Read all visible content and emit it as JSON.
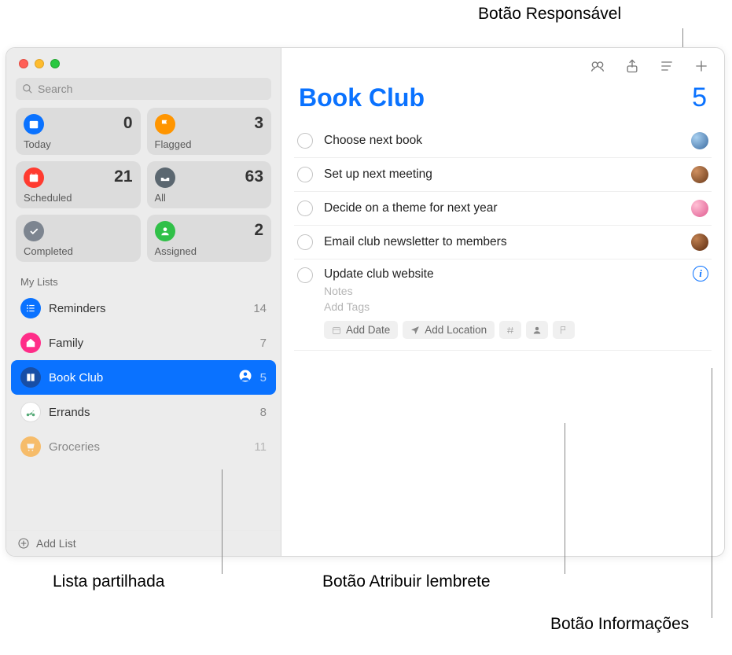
{
  "callouts": {
    "top_right": "Botão Responsável",
    "bottom_left": "Lista partilhada",
    "bottom_mid": "Botão Atribuir lembrete",
    "bottom_right": "Botão Informações"
  },
  "sidebar": {
    "search_placeholder": "Search",
    "cards": [
      {
        "label": "Today",
        "count": "0",
        "color": "#0a72ff",
        "icon": "calendar"
      },
      {
        "label": "Flagged",
        "count": "3",
        "color": "#ff9500",
        "icon": "flag"
      },
      {
        "label": "Scheduled",
        "count": "21",
        "color": "#ff3b30",
        "icon": "schedule"
      },
      {
        "label": "All",
        "count": "63",
        "color": "#5b6770",
        "icon": "tray"
      },
      {
        "label": "Completed",
        "count": "",
        "color": "#7d8590",
        "icon": "check"
      },
      {
        "label": "Assigned",
        "count": "2",
        "color": "#30c048",
        "icon": "person"
      }
    ],
    "section_header": "My Lists",
    "lists": [
      {
        "name": "Reminders",
        "count": "14",
        "color": "#0a72ff",
        "icon": "list",
        "shared": false,
        "selected": false
      },
      {
        "name": "Family",
        "count": "7",
        "color": "#ff2d88",
        "icon": "home",
        "shared": false,
        "selected": false
      },
      {
        "name": "Book Club",
        "count": "5",
        "color": "#174ea6",
        "icon": "book",
        "shared": true,
        "selected": true
      },
      {
        "name": "Errands",
        "count": "8",
        "color": "#ffffff",
        "icon": "scooter",
        "shared": false,
        "selected": false
      },
      {
        "name": "Groceries",
        "count": "11",
        "color": "#ff9500",
        "icon": "cart",
        "shared": false,
        "selected": false
      }
    ],
    "add_list": "Add List"
  },
  "main": {
    "title": "Book Club",
    "count": "5",
    "items": [
      {
        "title": "Choose next book",
        "avatar": "#60a5d8"
      },
      {
        "title": "Set up next meeting",
        "avatar": "#b05a2a"
      },
      {
        "title": "Decide on a theme for next year",
        "avatar": "#f48fb1"
      },
      {
        "title": "Email club newsletter to members",
        "avatar": "#8a4a2a"
      }
    ],
    "expanded_item": {
      "title": "Update club website",
      "notes_placeholder": "Notes",
      "tags_placeholder": "Add Tags",
      "chip_date": "Add Date",
      "chip_location": "Add Location"
    }
  }
}
